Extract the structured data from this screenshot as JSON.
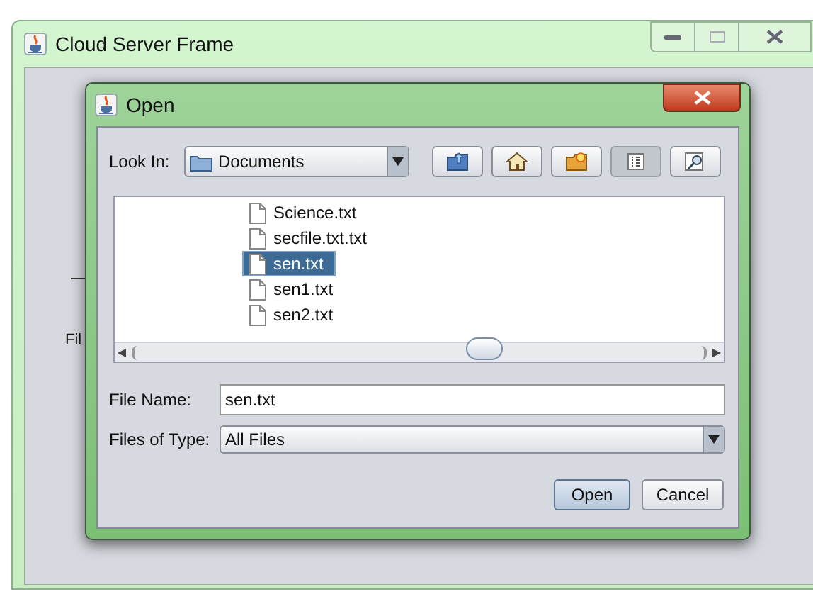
{
  "frame": {
    "title": "Cloud Server Frame",
    "label": "Fil"
  },
  "dialog": {
    "title": "Open",
    "look_in": {
      "label": "Look In:",
      "value": "Documents"
    },
    "toolbar": [
      {
        "kind": "up",
        "selected": false
      },
      {
        "kind": "home",
        "selected": false
      },
      {
        "kind": "new-folder",
        "selected": false
      },
      {
        "kind": "list",
        "selected": true
      },
      {
        "kind": "details",
        "selected": false
      }
    ],
    "files": [
      {
        "name": "Science.txt",
        "selected": false
      },
      {
        "name": "secfile.txt.txt",
        "selected": false
      },
      {
        "name": "sen.txt",
        "selected": true
      },
      {
        "name": "sen1.txt",
        "selected": false
      },
      {
        "name": "sen2.txt",
        "selected": false
      }
    ],
    "file_name": {
      "label": "File Name:",
      "value": "sen.txt"
    },
    "file_type": {
      "label": "Files of Type:",
      "value": "All Files"
    },
    "buttons": [
      {
        "label": "Open",
        "kind": "default"
      },
      {
        "label": "Cancel",
        "kind": "normal"
      }
    ]
  }
}
